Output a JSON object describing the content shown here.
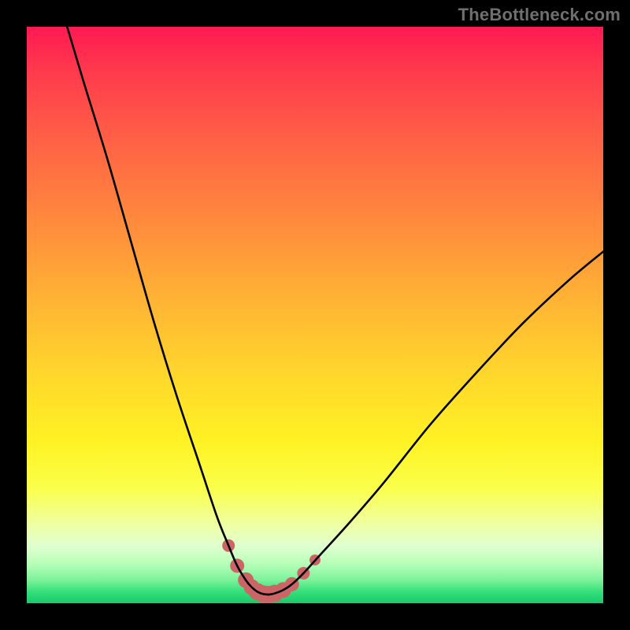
{
  "watermark": "TheBottleneck.com",
  "chart_data": {
    "type": "line",
    "title": "",
    "xlabel": "",
    "ylabel": "",
    "xlim": [
      0,
      100
    ],
    "ylim": [
      0,
      100
    ],
    "series": [
      {
        "name": "left-curve",
        "x": [
          7,
          10,
          14,
          18,
          22,
          26,
          30,
          33,
          35,
          36.5,
          38,
          39,
          40,
          41,
          42
        ],
        "y": [
          100,
          90,
          77,
          63,
          49,
          36,
          24,
          15,
          10,
          6.5,
          4,
          2.8,
          2,
          1.6,
          1.5
        ]
      },
      {
        "name": "right-curve",
        "x": [
          42,
          43,
          44.5,
          46,
          48,
          51,
          56,
          62,
          70,
          78,
          86,
          94,
          100
        ],
        "y": [
          1.5,
          1.7,
          2.3,
          3.3,
          5.2,
          8.5,
          14,
          21,
          31,
          40,
          48.5,
          56,
          61
        ]
      }
    ],
    "markers": {
      "name": "overlay-dots",
      "color": "#cc6666",
      "points": [
        {
          "x": 35,
          "y": 10,
          "r": 8
        },
        {
          "x": 36.5,
          "y": 6.5,
          "r": 9
        },
        {
          "x": 38,
          "y": 4,
          "r": 10
        },
        {
          "x": 39,
          "y": 2.8,
          "r": 10
        },
        {
          "x": 40,
          "y": 2,
          "r": 11
        },
        {
          "x": 41,
          "y": 1.6,
          "r": 11
        },
        {
          "x": 42,
          "y": 1.5,
          "r": 11
        },
        {
          "x": 43,
          "y": 1.7,
          "r": 11
        },
        {
          "x": 44.5,
          "y": 2.3,
          "r": 10
        },
        {
          "x": 46,
          "y": 3.3,
          "r": 9
        },
        {
          "x": 48,
          "y": 5.2,
          "r": 8
        },
        {
          "x": 50,
          "y": 7.5,
          "r": 7
        }
      ]
    },
    "gradient_stops": [
      {
        "pos": 0,
        "color": "#ff1a52"
      },
      {
        "pos": 50,
        "color": "#ffc830"
      },
      {
        "pos": 80,
        "color": "#faff4a"
      },
      {
        "pos": 100,
        "color": "#19c96a"
      }
    ]
  }
}
